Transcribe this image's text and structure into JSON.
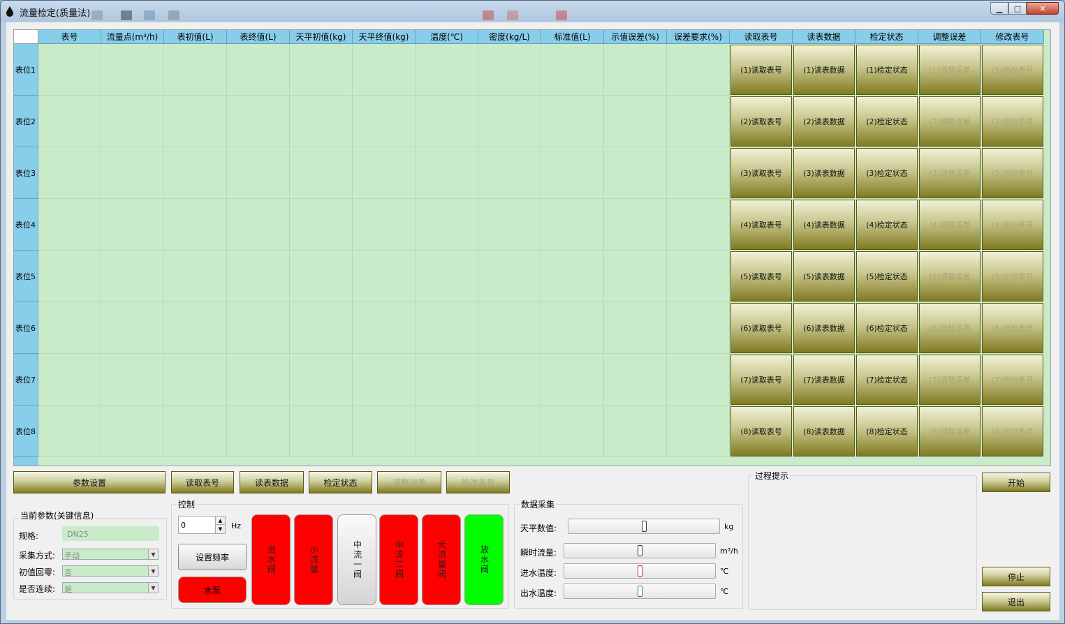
{
  "window": {
    "title": "流量检定(质量法)",
    "min_icon": "minimize-icon",
    "max_icon": "maximize-icon",
    "close_icon": "close-icon",
    "min_glyph": "▁",
    "max_glyph": "□",
    "close_glyph": "✕"
  },
  "grid": {
    "columns": [
      "表号",
      "流量点(m³/h)",
      "表初值(L)",
      "表终值(L)",
      "天平初值(kg)",
      "天平终值(kg)",
      "温度(℃)",
      "密度(kg/L)",
      "标准值(L)",
      "示值误差(%)",
      "误差要求(%)",
      "读取表号",
      "读表数据",
      "检定状态",
      "调整误差",
      "修改表号"
    ],
    "rows": [
      {
        "label": "表位1",
        "b1": "(1)读取表号",
        "b2": "(1)读表数据",
        "b3": "(1)检定状态",
        "b4": "(1)调整误差",
        "b5": "(1)修改表号"
      },
      {
        "label": "表位2",
        "b1": "(2)读取表号",
        "b2": "(2)读表数据",
        "b3": "(2)检定状态",
        "b4": "(2)调整误差",
        "b5": "(2)修改表号"
      },
      {
        "label": "表位3",
        "b1": "(3)读取表号",
        "b2": "(3)读表数据",
        "b3": "(3)检定状态",
        "b4": "(3)调整误差",
        "b5": "(3)修改表号"
      },
      {
        "label": "表位4",
        "b1": "(4)读取表号",
        "b2": "(4)读表数据",
        "b3": "(4)检定状态",
        "b4": "(4)调整误差",
        "b5": "(4)修改表号"
      },
      {
        "label": "表位5",
        "b1": "(5)读取表号",
        "b2": "(5)读表数据",
        "b3": "(5)检定状态",
        "b4": "(5)调整误差",
        "b5": "(5)修改表号"
      },
      {
        "label": "表位6",
        "b1": "(6)读取表号",
        "b2": "(6)读表数据",
        "b3": "(6)检定状态",
        "b4": "(6)调整误差",
        "b5": "(6)修改表号"
      },
      {
        "label": "表位7",
        "b1": "(7)读取表号",
        "b2": "(7)读表数据",
        "b3": "(7)检定状态",
        "b4": "(7)调整误差",
        "b5": "(7)修改表号"
      },
      {
        "label": "表位8",
        "b1": "(8)读取表号",
        "b2": "(8)读表数据",
        "b3": "(8)检定状态",
        "b4": "(8)调整误差",
        "b5": "(8)修改表号"
      }
    ]
  },
  "toolbar": {
    "params": "参数设置",
    "read_no": "读取表号",
    "read_data": "读表数据",
    "check_status": "检定状态",
    "adjust_error": "调整误差",
    "modify_no": "修改表号"
  },
  "params": {
    "group_title": "当前参数(关键信息)",
    "spec_label": "规格:",
    "spec_value": "DN25",
    "collect_label": "采集方式:",
    "collect_value": "手动",
    "zero_label": "初值回零:",
    "zero_value": "否",
    "continuous_label": "是否连续:",
    "continuous_value": "是"
  },
  "control": {
    "group_title": "控制",
    "freq_value": "0",
    "freq_unit": "Hz",
    "set_freq": "设置频率",
    "pump": "水泵",
    "valves": [
      {
        "label": "进水阀",
        "state": "red"
      },
      {
        "label": "小流量",
        "state": "red"
      },
      {
        "label": "中流一阀",
        "state": "white"
      },
      {
        "label": "中流二阀",
        "state": "red"
      },
      {
        "label": "大流量阀",
        "state": "red"
      },
      {
        "label": "放水阀",
        "state": "green"
      }
    ]
  },
  "acquisition": {
    "group_title": "数据采集",
    "items": [
      {
        "label": "天平数值:",
        "unit": "kg",
        "thumb_color": "#333333",
        "level": 0.5
      },
      {
        "label": "瞬时流量:",
        "unit": "m³/h",
        "thumb_color": "#333333",
        "level": 0.5
      },
      {
        "label": "进水温度:",
        "unit": "℃",
        "thumb_color": "#cc2222",
        "level": 0.5
      },
      {
        "label": "出水温度:",
        "unit": "℃",
        "thumb_color": "#228822",
        "level": 0.5
      }
    ]
  },
  "process": {
    "group_title": "过程提示"
  },
  "actions": {
    "start": "开始",
    "stop": "停止",
    "exit": "退出"
  },
  "colors": {
    "grid_bg": "#c9ebc9",
    "header_bg": "#87ceeb",
    "valve_on": "#00ff00",
    "valve_off": "#ff0000"
  }
}
